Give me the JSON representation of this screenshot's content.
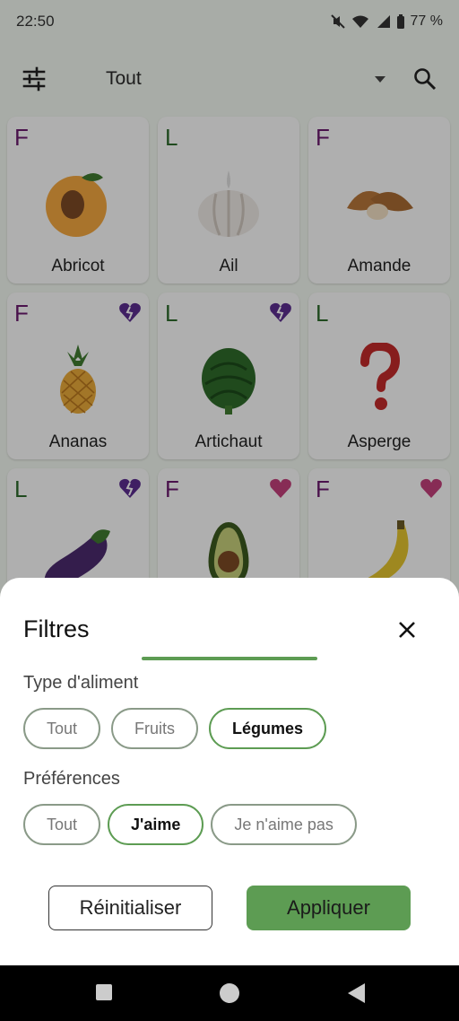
{
  "status_bar": {
    "time": "22:50",
    "battery": "77 %"
  },
  "toolbar": {
    "title": "Tout",
    "filter_icon": "sliders-icon",
    "search_icon": "search-icon"
  },
  "foods": [
    {
      "type": "F",
      "name": "Abricot",
      "preference": "none",
      "icon": "apricot-icon"
    },
    {
      "type": "L",
      "name": "Ail",
      "preference": "none",
      "icon": "garlic-icon"
    },
    {
      "type": "F",
      "name": "Amande",
      "preference": "none",
      "icon": "almond-icon"
    },
    {
      "type": "F",
      "name": "Ananas",
      "preference": "dislike",
      "icon": "pineapple-icon"
    },
    {
      "type": "L",
      "name": "Artichaut",
      "preference": "dislike",
      "icon": "artichoke-icon"
    },
    {
      "type": "L",
      "name": "Asperge",
      "preference": "none",
      "icon": "question-mark-icon"
    },
    {
      "type": "L",
      "name": "",
      "preference": "dislike",
      "icon": "eggplant-icon"
    },
    {
      "type": "F",
      "name": "",
      "preference": "like",
      "icon": "avocado-icon"
    },
    {
      "type": "F",
      "name": "",
      "preference": "like",
      "icon": "banana-icon"
    }
  ],
  "filters_sheet": {
    "title": "Filtres",
    "food_type_label": "Type d'aliment",
    "food_type_options": [
      {
        "label": "Tout",
        "selected": false
      },
      {
        "label": "Fruits",
        "selected": false
      },
      {
        "label": "Légumes",
        "selected": true
      }
    ],
    "preferences_label": "Préférences",
    "preference_options": [
      {
        "label": "Tout",
        "selected": false
      },
      {
        "label": "J'aime",
        "selected": true
      },
      {
        "label": "Je n'aime pas",
        "selected": false
      }
    ],
    "reset_label": "Réinitialiser",
    "apply_label": "Appliquer"
  },
  "colors": {
    "accent": "#5d9c53",
    "fruit_letter": "#6a1a6d",
    "vegetable_letter": "#2d6a2b",
    "dislike_heart": "#5b2d8e",
    "like_heart": "#c2407a"
  }
}
